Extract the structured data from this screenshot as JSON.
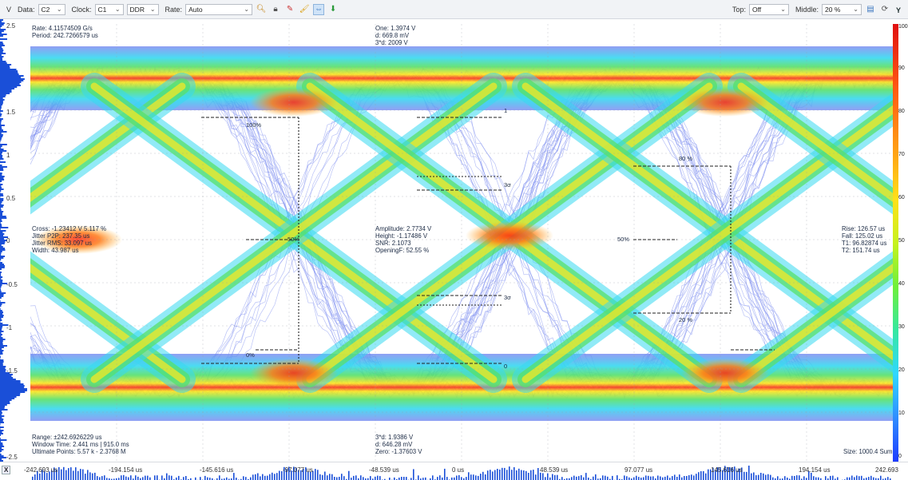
{
  "toolbar": {
    "data_label": "Data:",
    "data_value": "C2",
    "clock_label": "Clock:",
    "clock_value": "C1",
    "clock_mode": "DDR",
    "rate_label": "Rate:",
    "rate_value": "Auto",
    "top_label": "Top:",
    "top_value": "Off",
    "middle_label": "Middle:",
    "middle_value": "20 %",
    "y_toggle": "Y"
  },
  "y_axis": {
    "unit": "V",
    "ticks": [
      "2.5",
      "1.5",
      "1",
      "0.5",
      "0",
      "-0.5",
      "-1",
      "-1.5",
      "-2.5"
    ]
  },
  "colorbar": {
    "ticks": [
      "100",
      "90",
      "80",
      "70",
      "60",
      "50",
      "40",
      "30",
      "20",
      "10",
      "0"
    ]
  },
  "x_axis": {
    "toggle": "X",
    "ticks": [
      "-242.693 us",
      "-194.154 us",
      "-145.616 us",
      "-97.077 us",
      "-48.539 us",
      "0 us",
      "48.539 us",
      "97.077 us",
      "145.616 us",
      "194.154 us",
      "242.693"
    ]
  },
  "overlay": {
    "top_left": [
      "Rate: 4.11574509 G/s",
      "Period: 242.7266579 us"
    ],
    "top_center": [
      "One: 1.3974 V",
      "d: 669.8 mV",
      "3*d: 2009 V"
    ],
    "left_middle": [
      "Cross: -1.23412 V  5.117 %",
      "Jitter P2P: 237.35 us",
      "Jitter RMS: 33.097 us",
      "Width: 43.987 us"
    ],
    "center_middle": [
      "Amplitude: 2.7734 V",
      "Height: -1.17486 V",
      "SNR: 2.1073",
      "OpeningF: 52.55 %"
    ],
    "right_middle": [
      "Rise: 126.57 us",
      "Fall: 125.02 us",
      "T1: 96.82874 us",
      "T2: 151.74 us"
    ],
    "bottom_left": [
      "Range: ±242.6926229 us",
      "Window Time: 2.441 ms | 915.0 ms",
      "Ultimate Points: 5.57 k - 2.3768 M"
    ],
    "bottom_center": [
      "3*d: 1.9386 V",
      "d: 646.28 mV",
      "Zero: -1.37603 V"
    ],
    "bottom_right": [
      "Size: 1000.4 Sum"
    ],
    "markers": {
      "pct100": "100%",
      "pct0": "0%",
      "pct50_left": "50%",
      "pct50_right": "50%",
      "pct80": "80 %",
      "pct20": "20 %",
      "one": "1",
      "zero": "0",
      "sigma_top": "3σ",
      "sigma_bottom": "3σ"
    }
  },
  "colors": {
    "trace": "#7f8ff0",
    "red": "#ff3d1a",
    "orange": "#ff9a1a",
    "yellow": "#ffe81f",
    "green": "#57e06a",
    "cyan": "#37d8f0"
  }
}
